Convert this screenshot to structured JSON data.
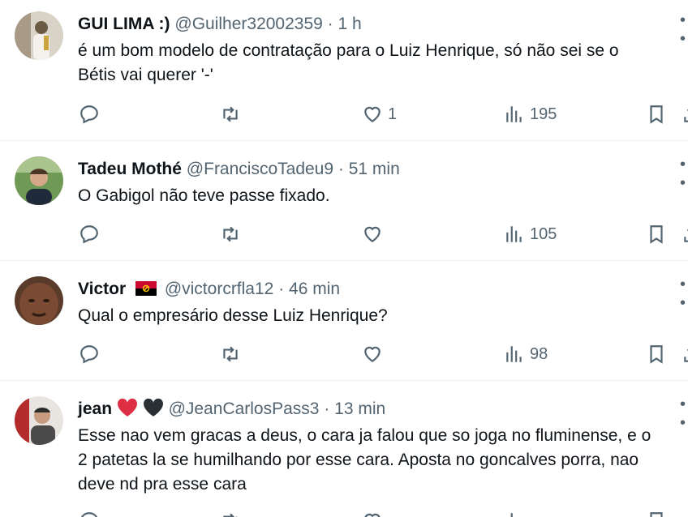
{
  "tweets": [
    {
      "name": "GUI LIMA :)",
      "handle": "@Guilher32002359",
      "time": "1 h",
      "text": "é um bom modelo de contratação para o Luiz Henrique, só não sei se o\nBétis vai querer '-'",
      "likes": "1",
      "views": "195",
      "avatar_colors": [
        "#cfc6b8",
        "#6b5a44"
      ]
    },
    {
      "name": "Tadeu Mothé",
      "handle": "@FranciscoTadeu9",
      "time": "51 min",
      "text": "O Gabigol não teve passe fixado.",
      "likes": "",
      "views": "105",
      "avatar_colors": [
        "#5e8a4a",
        "#c79b7f"
      ]
    },
    {
      "name": "Victor",
      "handle": "@victorcrfla12",
      "time": "46 min",
      "text": "Qual o empresário desse Luiz Henrique?",
      "likes": "",
      "views": "98",
      "flag": "angola-flag",
      "avatar_colors": [
        "#3b2418",
        "#7a4a33"
      ]
    },
    {
      "name": "jean",
      "handle": "@JeanCarlosPass3",
      "time": "13 min",
      "text": "Esse nao vem gracas a deus, o cara ja falou que so joga no fluminense, e o\n2 patetas la se humilhando por esse cara. Aposta no goncalves porra, nao\ndeve nd pra esse cara",
      "likes": "",
      "views": "",
      "emojis": [
        "red-heart",
        "black-heart"
      ],
      "avatar_colors": [
        "#b32b2b",
        "#4a4a4a"
      ]
    }
  ],
  "separator": "·",
  "more_icon": "ellipsis-icon",
  "colors": {
    "text": "#0f1419",
    "muted": "#536471",
    "border": "#eff3f4"
  }
}
